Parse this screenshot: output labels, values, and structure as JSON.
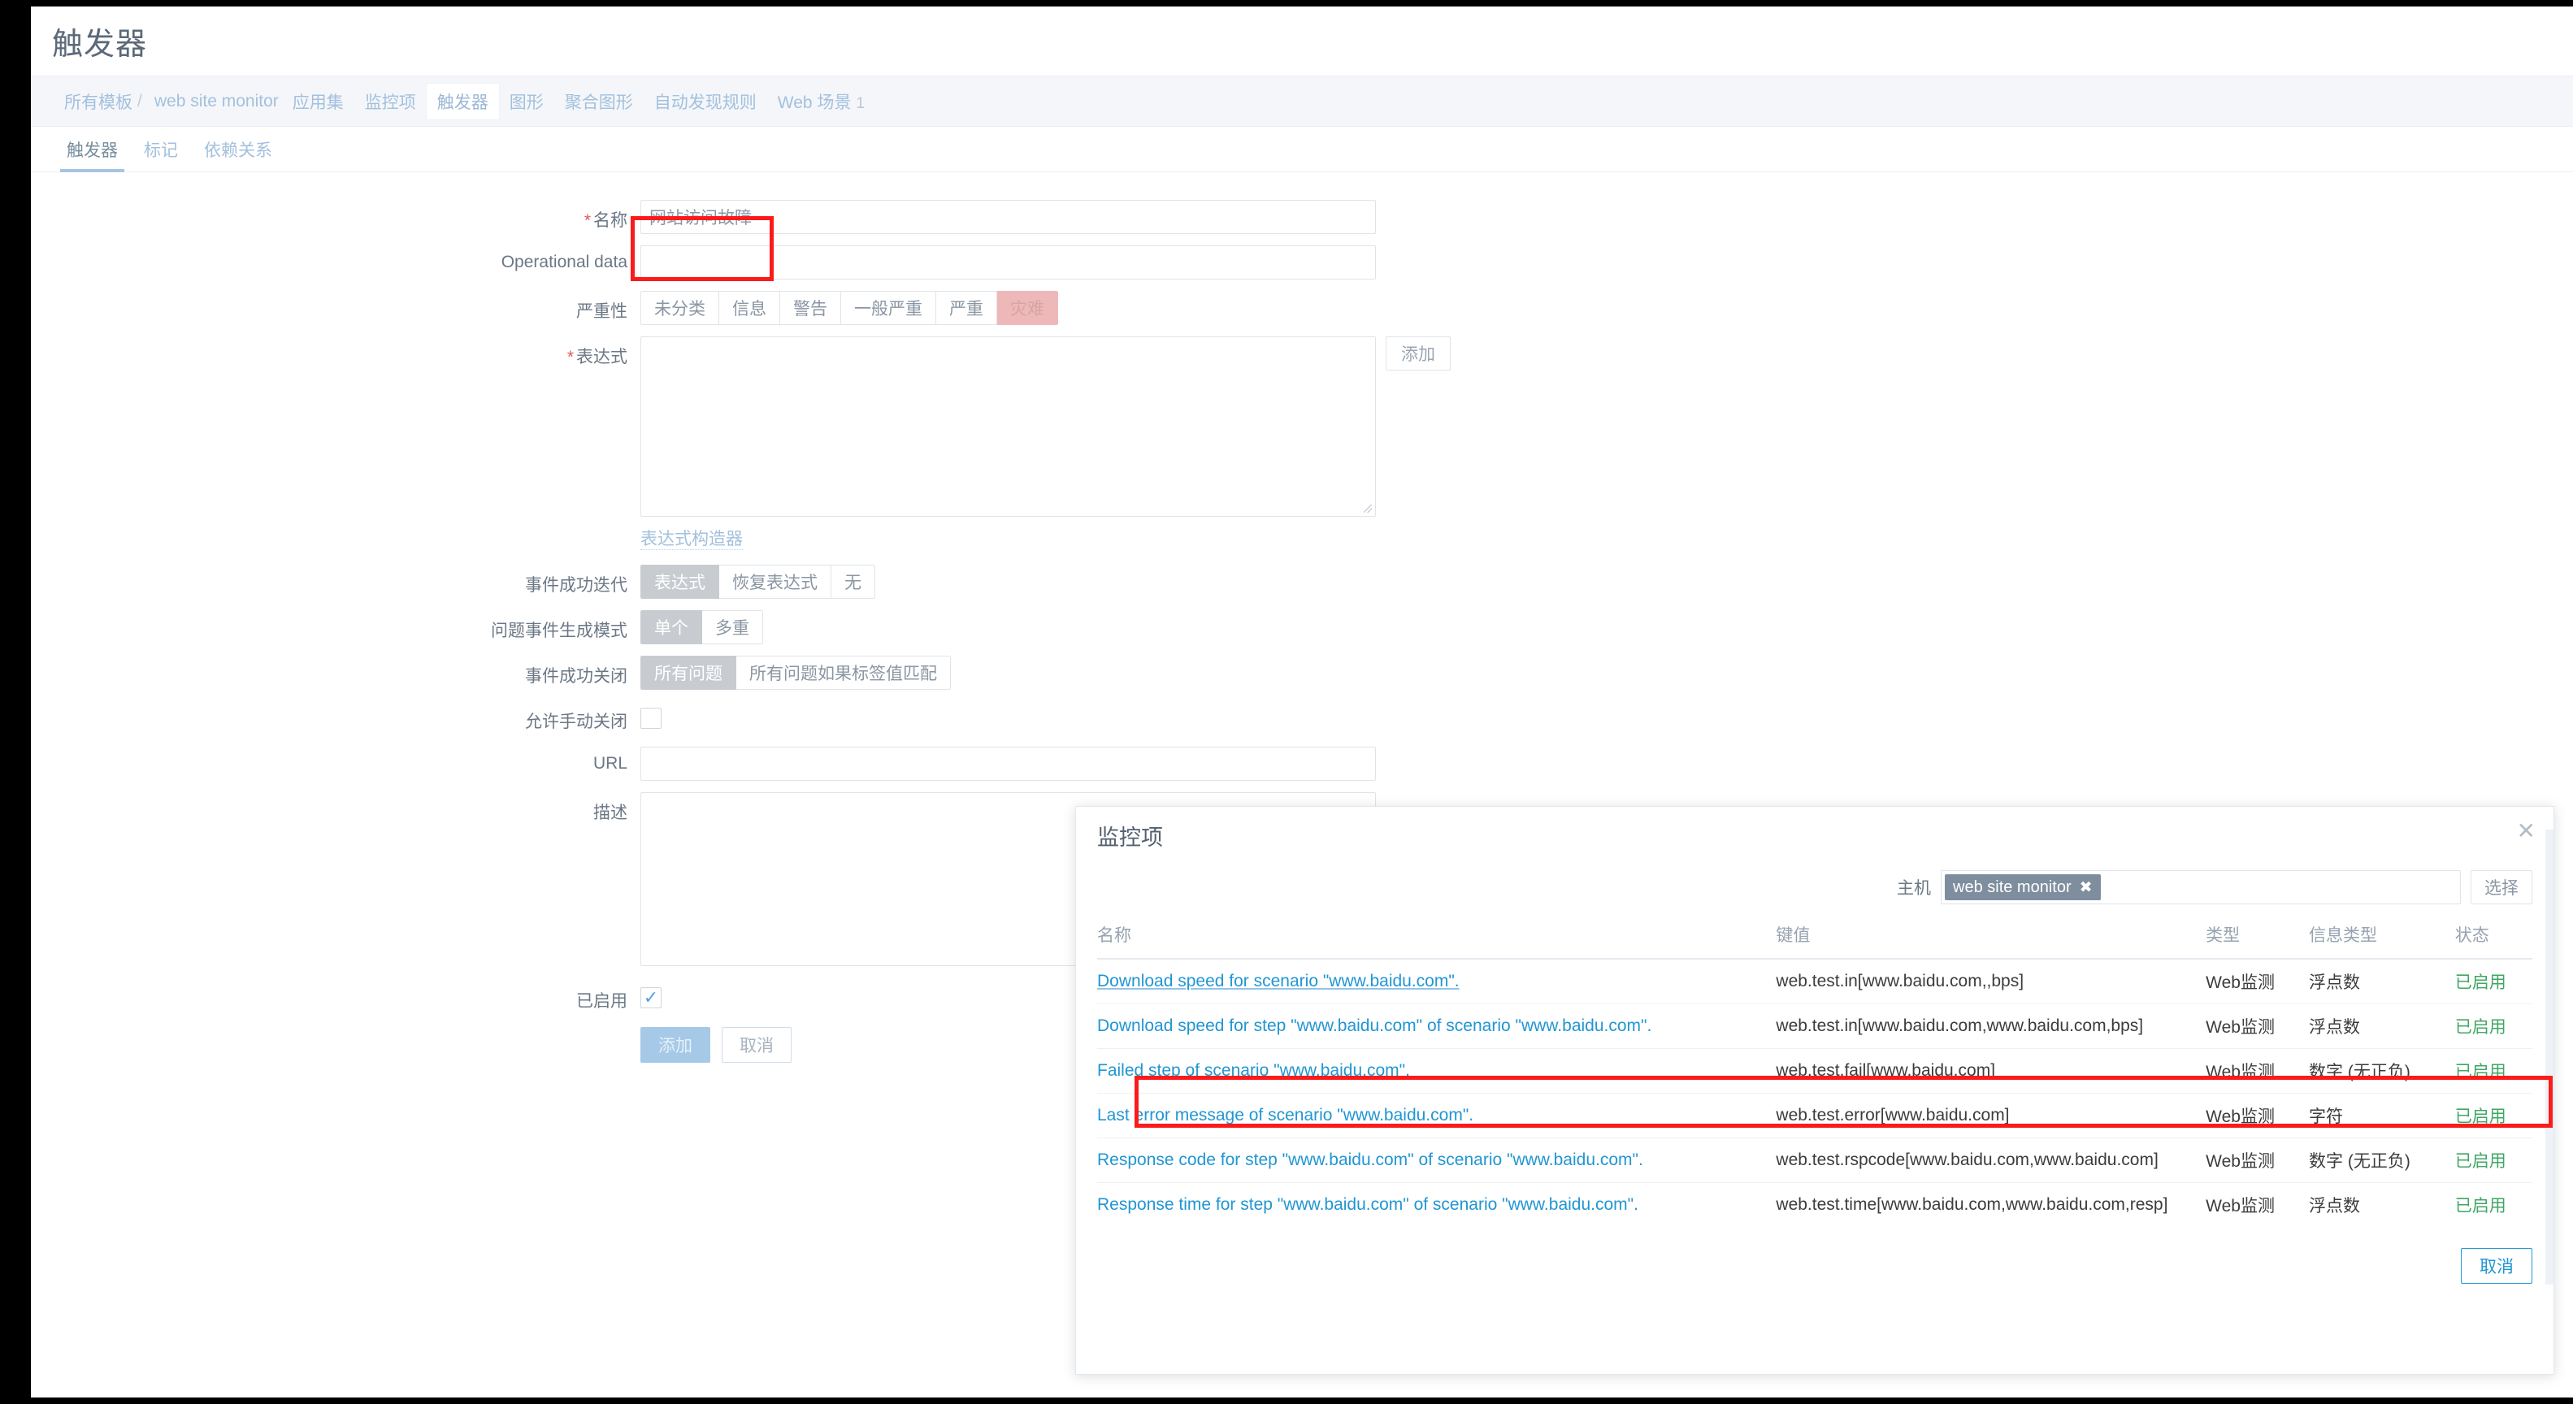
{
  "header": {
    "title": "触发器"
  },
  "breadcrumb": {
    "root": "所有模板",
    "separator": "/",
    "template": "web site monitor",
    "items": [
      {
        "label": "应用集",
        "count": ""
      },
      {
        "label": "监控项",
        "count": ""
      },
      {
        "label": "触发器",
        "count": ""
      },
      {
        "label": "图形",
        "count": ""
      },
      {
        "label": "聚合图形",
        "count": ""
      },
      {
        "label": "自动发现规则",
        "count": ""
      },
      {
        "label": "Web 场景",
        "count": "1"
      }
    ],
    "active_index": 2
  },
  "tabs": [
    {
      "label": "触发器"
    },
    {
      "label": "标记"
    },
    {
      "label": "依赖关系"
    }
  ],
  "active_tab": 0,
  "form": {
    "name": {
      "label": "名称",
      "required": true,
      "value": "网站访问故障",
      "placeholder": ""
    },
    "operational_data": {
      "label": "Operational data",
      "value": "",
      "placeholder": ""
    },
    "severity": {
      "label": "严重性",
      "options": [
        "未分类",
        "信息",
        "警告",
        "一般严重",
        "严重",
        "灾难"
      ],
      "selected": "灾难"
    },
    "expression": {
      "label": "表达式",
      "required": true,
      "value": "",
      "add_button": "添加",
      "constructor_link": "表达式构造器"
    },
    "ok_event_generation": {
      "label": "事件成功迭代",
      "options": [
        "表达式",
        "恢复表达式",
        "无"
      ],
      "selected": "表达式"
    },
    "problem_event_mode": {
      "label": "问题事件生成模式",
      "options": [
        "单个",
        "多重"
      ],
      "selected": "单个"
    },
    "ok_event_closes": {
      "label": "事件成功关闭",
      "options": [
        "所有问题",
        "所有问题如果标签值匹配"
      ],
      "selected": "所有问题"
    },
    "allow_manual_close": {
      "label": "允许手动关闭",
      "checked": false
    },
    "url": {
      "label": "URL",
      "value": "",
      "placeholder": ""
    },
    "description": {
      "label": "描述",
      "value": "",
      "placeholder": ""
    },
    "enabled": {
      "label": "已启用",
      "checked": true
    },
    "submit": "添加",
    "cancel": "取消"
  },
  "modal": {
    "title": "监控项",
    "close_icon": "close-icon",
    "host_label": "主机",
    "host_chip": "web site monitor",
    "host_chip_remove": "✖",
    "select_button": "选择",
    "columns": [
      "名称",
      "键值",
      "类型",
      "信息类型",
      "状态"
    ],
    "rows": [
      {
        "name": "Download speed for scenario \"www.baidu.com\".",
        "key": "web.test.in[www.baidu.com,,bps]",
        "type": "Web监测",
        "value_type": "浮点数",
        "status": "已启用",
        "highlighted": false
      },
      {
        "name": "Download speed for step \"www.baidu.com\" of scenario \"www.baidu.com\".",
        "key": "web.test.in[www.baidu.com,www.baidu.com,bps]",
        "type": "Web监测",
        "value_type": "浮点数",
        "status": "已启用",
        "highlighted": false
      },
      {
        "name": "Failed step of scenario \"www.baidu.com\".",
        "key": "web.test.fail[www.baidu.com]",
        "type": "Web监测",
        "value_type": "数字 (无正负)",
        "status": "已启用",
        "highlighted": true
      },
      {
        "name": "Last error message of scenario \"www.baidu.com\".",
        "key": "web.test.error[www.baidu.com]",
        "type": "Web监测",
        "value_type": "字符",
        "status": "已启用",
        "highlighted": false
      },
      {
        "name": "Response code for step \"www.baidu.com\" of scenario \"www.baidu.com\".",
        "key": "web.test.rspcode[www.baidu.com,www.baidu.com]",
        "type": "Web监测",
        "value_type": "数字 (无正负)",
        "status": "已启用",
        "highlighted": false
      },
      {
        "name": "Response time for step \"www.baidu.com\" of scenario \"www.baidu.com\".",
        "key": "web.test.time[www.baidu.com,www.baidu.com,resp]",
        "type": "Web监测",
        "value_type": "浮点数",
        "status": "已启用",
        "highlighted": false
      }
    ],
    "cancel_button": "取消"
  },
  "colors": {
    "annotation_red": "#fc1b1b",
    "link_blue": "#2196d3",
    "status_green": "#40a664",
    "disaster_pink": "#eeb8b8",
    "selected_gray": "#c8ccd1",
    "primary_button": "#a5c9e7"
  }
}
